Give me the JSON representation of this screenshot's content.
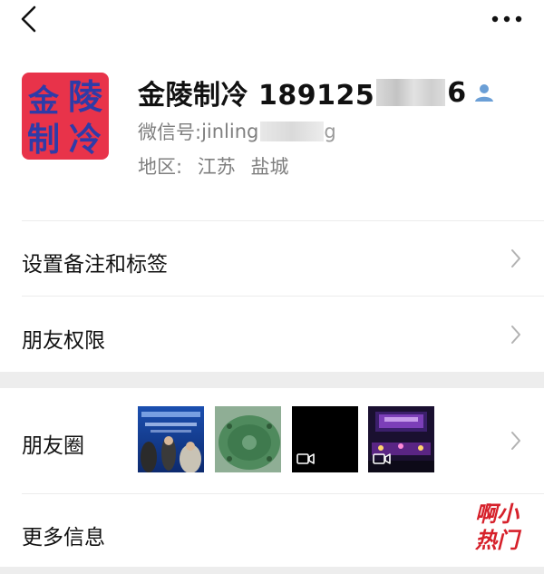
{
  "header": {
    "back_icon": "chevron-left-icon",
    "more_icon": "more-horizontal-icon"
  },
  "profile": {
    "avatar_text": [
      "金",
      "陵",
      "制",
      "冷"
    ],
    "name_prefix": "金陵制冷 189125",
    "name_suffix": "6",
    "verify_icon": "person-icon",
    "wechat_label": "微信号: ",
    "wechat_value": "jinling",
    "wechat_suffix": "g",
    "region_label": "地区:",
    "region_province": "江苏",
    "region_city": "盐城"
  },
  "menu": {
    "remark": "设置备注和标签",
    "permissions": "朋友权限",
    "moments": "朋友圈",
    "more_info": "更多信息"
  },
  "moments_thumbs": [
    {
      "kind": "event-photo",
      "icon": "image"
    },
    {
      "kind": "product-photo",
      "icon": "image"
    },
    {
      "kind": "video",
      "icon": "video-icon"
    },
    {
      "kind": "stage-video",
      "icon": "video-icon"
    }
  ],
  "watermark": {
    "line1": "啊小",
    "line2": "热门"
  },
  "colors": {
    "avatar_bg": "#e8334a",
    "avatar_text": "#2e3ba8",
    "verify": "#6b9fd6",
    "chevron": "#b2b2b2",
    "secondary_text": "#7f7f7f",
    "watermark": "#d6202a"
  }
}
